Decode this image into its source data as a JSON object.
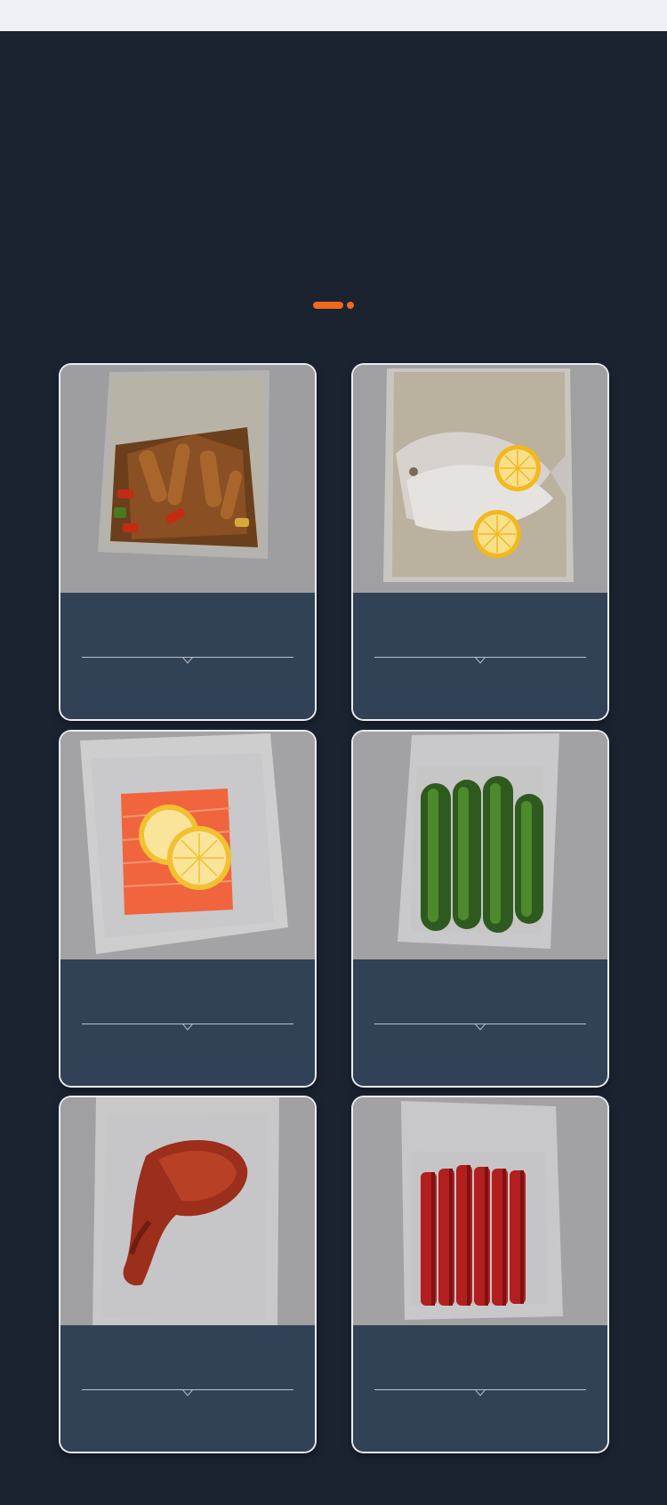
{
  "theme": {
    "accent": "#ef6a1c",
    "background": "#1b2331",
    "card_caption_bg": "#324256"
  },
  "carousel_indicator": {
    "active_index": 0,
    "count": 2
  },
  "cards": [
    {
      "subject": "vacuum-sealed-stir-fried-chicken-with-peppers"
    },
    {
      "subject": "vacuum-sealed-fish-with-lemon-slices"
    },
    {
      "subject": "vacuum-sealed-salmon-fillet-with-lemon"
    },
    {
      "subject": "vacuum-sealed-cucumbers"
    },
    {
      "subject": "vacuum-sealed-braised-duck-leg"
    },
    {
      "subject": "vacuum-sealed-sausages"
    }
  ]
}
